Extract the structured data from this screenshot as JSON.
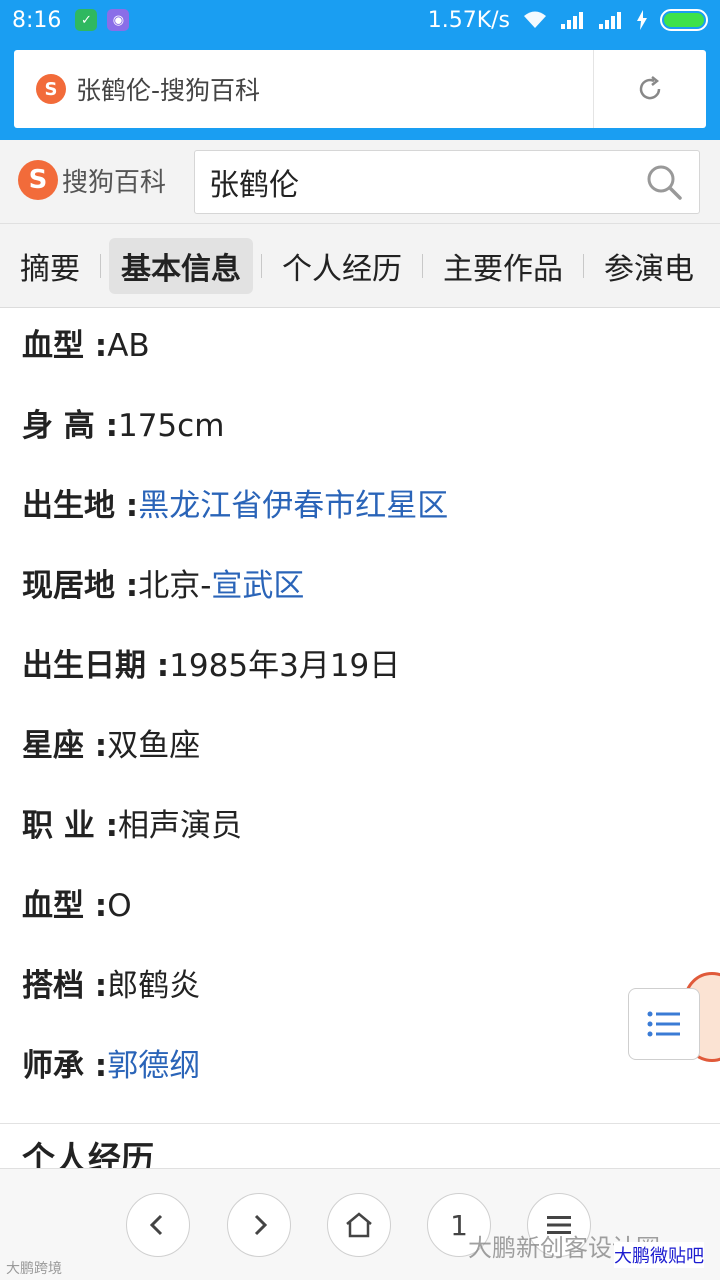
{
  "status_bar": {
    "time": "8:16",
    "speed": "1.57K/s",
    "icons": [
      "shield-icon",
      "app-icon",
      "wifi-icon",
      "signal-icon",
      "signal-icon",
      "charging-icon",
      "battery-icon"
    ]
  },
  "browser": {
    "url_title": "张鹤伦-搜狗百科",
    "favicon_letter": "S"
  },
  "site": {
    "logo_letter": "S",
    "logo_text": "搜狗百科",
    "search_value": "张鹤伦"
  },
  "tabs": [
    {
      "label": "摘要",
      "active": false
    },
    {
      "label": "基本信息",
      "active": true
    },
    {
      "label": "个人经历",
      "active": false
    },
    {
      "label": "主要作品",
      "active": false
    },
    {
      "label": "参演电",
      "active": false
    }
  ],
  "info": [
    {
      "label": "血型 :",
      "value": "AB",
      "link": ""
    },
    {
      "label": "身 高 :",
      "value": "175cm",
      "link": ""
    },
    {
      "label": "出生地 :",
      "value": "",
      "link": "黑龙江省伊春市红星区"
    },
    {
      "label": "现居地 :",
      "value": "北京-",
      "link": "宣武区"
    },
    {
      "label": "出生日期 :",
      "value": "1985年3月19日",
      "link": ""
    },
    {
      "label": "星座 :",
      "value": "双鱼座",
      "link": ""
    },
    {
      "label": "职 业 :",
      "value": "相声演员",
      "link": ""
    },
    {
      "label": "血型 :",
      "value": "O",
      "link": ""
    },
    {
      "label": "搭档 :",
      "value": "郎鹤炎",
      "link": ""
    },
    {
      "label": "师承 :",
      "value": "",
      "link": "郭德纲"
    }
  ],
  "section_heading": "个人经历",
  "bottom_nav": {
    "tab_count": "1",
    "buttons": [
      "back-icon",
      "forward-icon",
      "home-icon",
      "tabs-icon",
      "menu-icon"
    ]
  },
  "watermarks": {
    "left": "大鹏跨境",
    "middle": "大鹏新创客设计圈",
    "right": "大鹏微贴吧"
  },
  "colors": {
    "accent": "#1a9ef2",
    "brand_orange": "#f26b3a",
    "link": "#2a64b8"
  }
}
